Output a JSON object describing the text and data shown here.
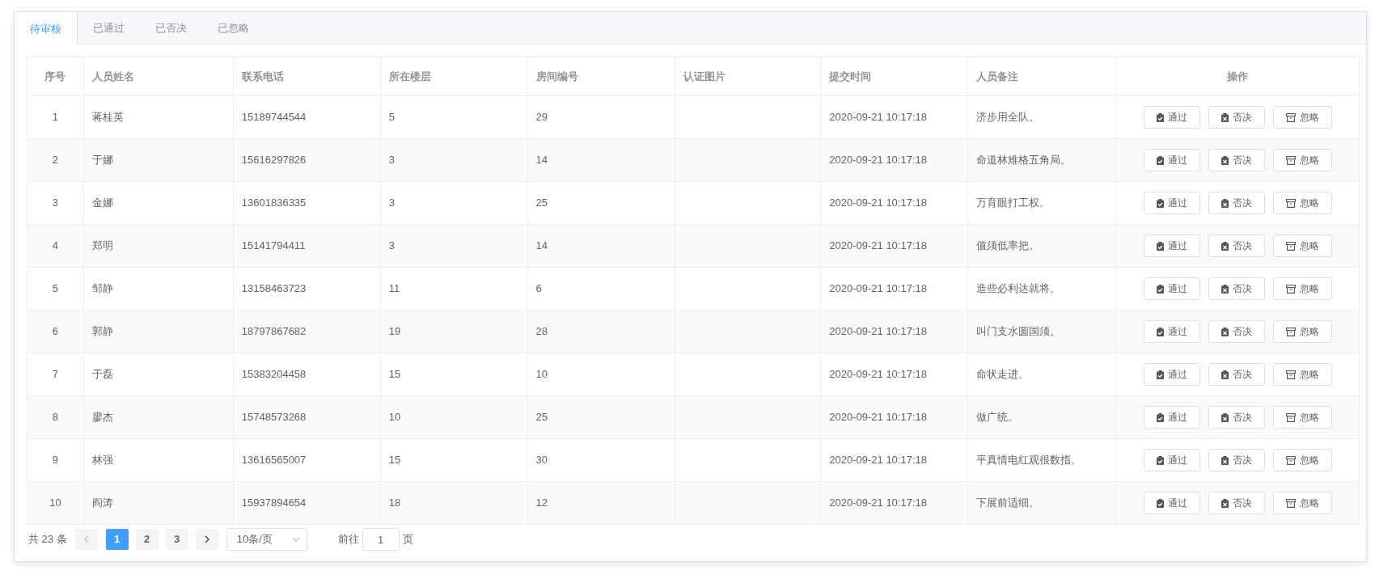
{
  "tabs": [
    {
      "label": "待审核",
      "selected": true
    },
    {
      "label": "已通过",
      "selected": false
    },
    {
      "label": "已否决",
      "selected": false
    },
    {
      "label": "已忽略",
      "selected": false
    }
  ],
  "table": {
    "columns": [
      "序号",
      "人员姓名",
      "联系电话",
      "所在楼层",
      "房间编号",
      "认证图片",
      "提交时间",
      "人员备注",
      "操作"
    ],
    "rows": [
      {
        "cells": [
          "1",
          "蒋桂英",
          "15189744544",
          "5",
          "29",
          "",
          "2020-09-21 10:17:18",
          "济步用全队。"
        ],
        "actions": [
          {
            "kind": "approve",
            "label": "通过"
          },
          {
            "kind": "reject",
            "label": "否决"
          },
          {
            "kind": "ignore",
            "label": "忽略"
          }
        ]
      },
      {
        "cells": [
          "2",
          "于娜",
          "15616297826",
          "3",
          "14",
          "",
          "2020-09-21 10:17:18",
          "命道林难格五角局。"
        ],
        "actions": [
          {
            "kind": "approve",
            "label": "通过"
          },
          {
            "kind": "reject",
            "label": "否决"
          },
          {
            "kind": "ignore",
            "label": "忽略"
          }
        ]
      },
      {
        "cells": [
          "3",
          "金娜",
          "13601836335",
          "3",
          "25",
          "",
          "2020-09-21 10:17:18",
          "万育眼打工权。"
        ],
        "actions": [
          {
            "kind": "approve",
            "label": "通过"
          },
          {
            "kind": "reject",
            "label": "否决"
          },
          {
            "kind": "ignore",
            "label": "忽略"
          }
        ]
      },
      {
        "cells": [
          "4",
          "郑明",
          "15141794411",
          "3",
          "14",
          "",
          "2020-09-21 10:17:18",
          "值须低率把。"
        ],
        "actions": [
          {
            "kind": "approve",
            "label": "通过"
          },
          {
            "kind": "reject",
            "label": "否决"
          },
          {
            "kind": "ignore",
            "label": "忽略"
          }
        ]
      },
      {
        "cells": [
          "5",
          "邹静",
          "13158463723",
          "11",
          "6",
          "",
          "2020-09-21 10:17:18",
          "造些必利达就将。"
        ],
        "actions": [
          {
            "kind": "approve",
            "label": "通过"
          },
          {
            "kind": "reject",
            "label": "否决"
          },
          {
            "kind": "ignore",
            "label": "忽略"
          }
        ]
      },
      {
        "cells": [
          "6",
          "郭静",
          "18797867682",
          "19",
          "28",
          "",
          "2020-09-21 10:17:18",
          "叫门支水圆国须。"
        ],
        "actions": [
          {
            "kind": "approve",
            "label": "通过"
          },
          {
            "kind": "reject",
            "label": "否决"
          },
          {
            "kind": "ignore",
            "label": "忽略"
          }
        ]
      },
      {
        "cells": [
          "7",
          "于磊",
          "15383204458",
          "15",
          "10",
          "",
          "2020-09-21 10:17:18",
          "命状走进。"
        ],
        "actions": [
          {
            "kind": "approve",
            "label": "通过"
          },
          {
            "kind": "reject",
            "label": "否决"
          },
          {
            "kind": "ignore",
            "label": "忽略"
          }
        ]
      },
      {
        "cells": [
          "8",
          "廖杰",
          "15748573268",
          "10",
          "25",
          "",
          "2020-09-21 10:17:18",
          "做广统。"
        ],
        "actions": [
          {
            "kind": "approve",
            "label": "通过"
          },
          {
            "kind": "reject",
            "label": "否决"
          },
          {
            "kind": "ignore",
            "label": "忽略"
          }
        ]
      },
      {
        "cells": [
          "9",
          "林强",
          "13616565007",
          "15",
          "30",
          "",
          "2020-09-21 10:17:18",
          "平真情电红观很数指。"
        ],
        "actions": [
          {
            "kind": "approve",
            "label": "通过"
          },
          {
            "kind": "reject",
            "label": "否决"
          },
          {
            "kind": "ignore",
            "label": "忽略"
          }
        ]
      },
      {
        "cells": [
          "10",
          "阎涛",
          "15937894654",
          "18",
          "12",
          "",
          "2020-09-21 10:17:18",
          "下展前适细。"
        ],
        "actions": [
          {
            "kind": "approve",
            "label": "通过"
          },
          {
            "kind": "reject",
            "label": "否决"
          },
          {
            "kind": "ignore",
            "label": "忽略"
          }
        ]
      }
    ]
  },
  "pagination": {
    "total": "共 23 条",
    "prev_disabled": true,
    "pages": [
      {
        "label": "1",
        "selected": true
      },
      {
        "label": "2",
        "selected": false
      },
      {
        "label": "3",
        "selected": false
      }
    ],
    "page_size": "10条/页",
    "goto_label": "前往",
    "goto_value": "1",
    "goto_suffix": "页"
  }
}
